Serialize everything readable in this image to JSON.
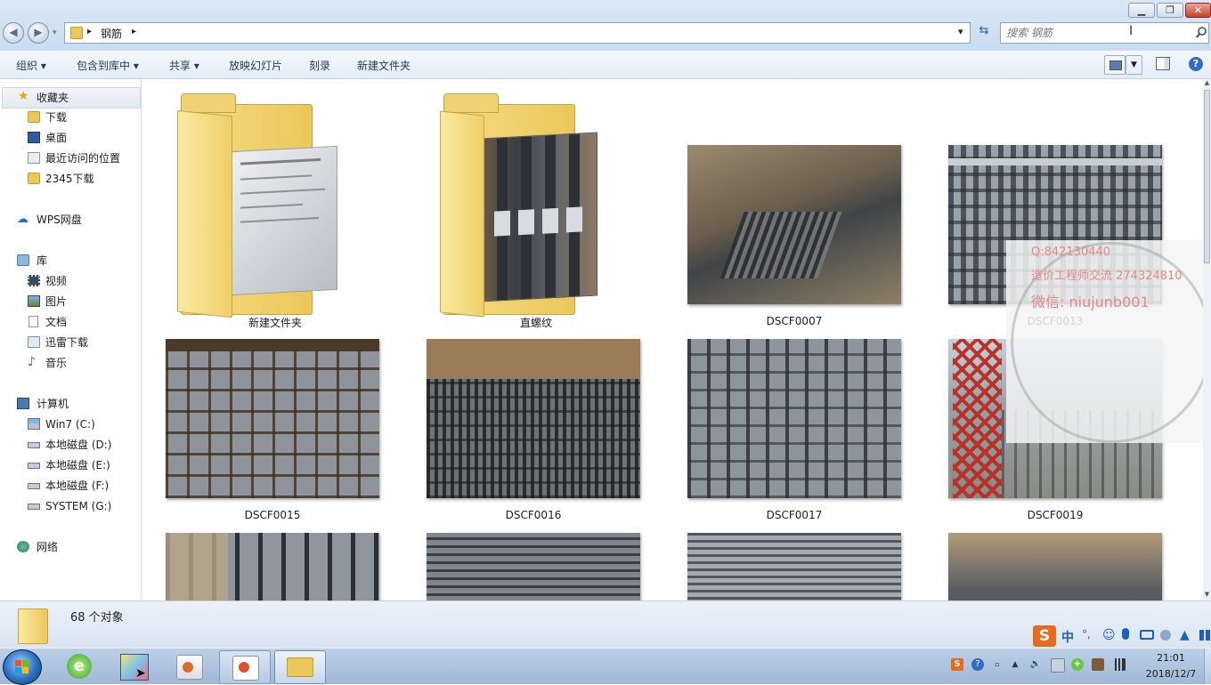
{
  "window": {
    "minimize_glyph": "▁",
    "maximize_glyph": "❐",
    "close_glyph": "✕"
  },
  "address": {
    "path_sep": "▸",
    "folder": "钢筋",
    "dropdown_glyph": "▾",
    "refresh_glyph": "⇆"
  },
  "search": {
    "placeholder": "搜索 钢筋",
    "icon": "search-icon"
  },
  "toolbar": {
    "organize": "组织 ▾",
    "include_library": "包含到库中 ▾",
    "share": "共享 ▾",
    "slideshow": "放映幻灯片",
    "burn": "刻录",
    "new_folder": "新建文件夹"
  },
  "sidebar": {
    "favorites": {
      "label": "收藏夹",
      "items": [
        "下载",
        "桌面",
        "最近访问的位置",
        "2345下载"
      ]
    },
    "wps": "WPS网盘",
    "libraries": {
      "label": "库",
      "items": [
        "视频",
        "图片",
        "文档",
        "迅雷下载",
        "音乐"
      ]
    },
    "computer": {
      "label": "计算机",
      "items": [
        "Win7 (C:)",
        "本地磁盘 (D:)",
        "本地磁盘 (E:)",
        "本地磁盘 (F:)",
        "SYSTEM (G:)"
      ]
    },
    "network": "网络"
  },
  "files": [
    {
      "name": "新建文件夹",
      "kind": "folder"
    },
    {
      "name": "直螺纹",
      "kind": "folder"
    },
    {
      "name": "DSCF0007",
      "kind": "image"
    },
    {
      "name": "DSCF0013",
      "kind": "image"
    },
    {
      "name": "DSCF0015",
      "kind": "image"
    },
    {
      "name": "DSCF0016",
      "kind": "image"
    },
    {
      "name": "DSCF0017",
      "kind": "image"
    },
    {
      "name": "DSCF0019",
      "kind": "image"
    },
    {
      "name": "",
      "kind": "image"
    },
    {
      "name": "",
      "kind": "image"
    },
    {
      "name": "",
      "kind": "image"
    },
    {
      "name": "",
      "kind": "image"
    }
  ],
  "watermark": {
    "line1": "Q:842130440",
    "line2": "造价工程师交流 274324810",
    "line3": "微信: niujunb001"
  },
  "status": {
    "count": "68 个对象"
  },
  "ime": {
    "lang": "中",
    "punct": "°,"
  },
  "clock": {
    "time": "21:01",
    "date": "2018/12/7"
  },
  "colors": {
    "accent": "#1e395b",
    "folder": "#ecc75a"
  }
}
